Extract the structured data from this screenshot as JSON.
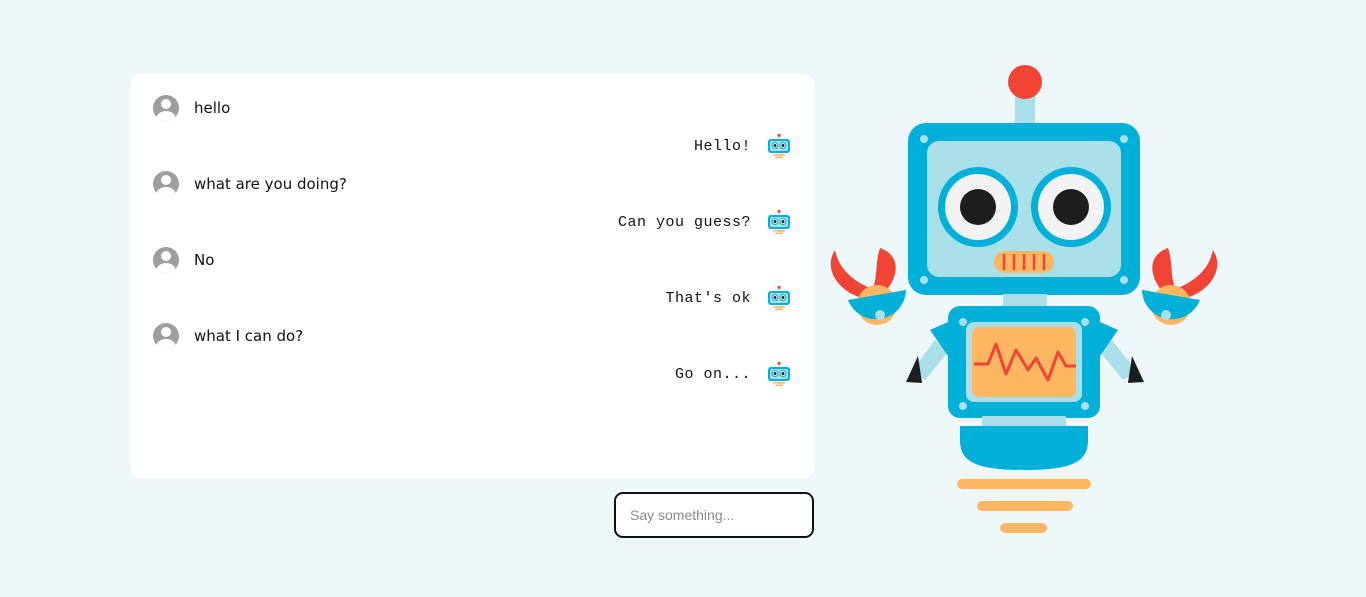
{
  "chat": {
    "messages": [
      {
        "sender": "user",
        "text": "hello"
      },
      {
        "sender": "bot",
        "text": "Hello!"
      },
      {
        "sender": "user",
        "text": "what are you doing?"
      },
      {
        "sender": "bot",
        "text": "Can you guess?"
      },
      {
        "sender": "user",
        "text": "No"
      },
      {
        "sender": "bot",
        "text": "That's ok"
      },
      {
        "sender": "user",
        "text": "what I can do?"
      },
      {
        "sender": "bot",
        "text": "Go on..."
      }
    ]
  },
  "input": {
    "placeholder": "Say something...",
    "value": ""
  },
  "icons": {
    "user_avatar": "user-avatar-icon",
    "bot_avatar": "robot-avatar-icon",
    "mascot": "robot-illustration"
  },
  "colors": {
    "background": "#eef7f9",
    "panel": "#ffffff",
    "robot_blue": "#00b0d8",
    "robot_light": "#a9dfe8",
    "robot_red": "#f04435",
    "robot_orange": "#fdb763"
  }
}
